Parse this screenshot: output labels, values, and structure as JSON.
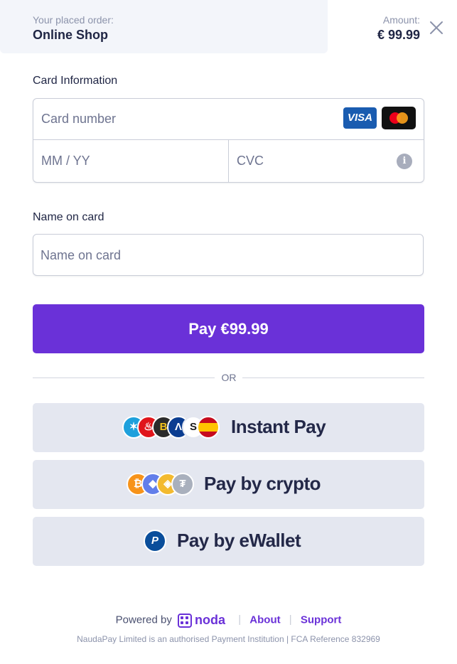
{
  "header": {
    "order_label": "Your placed order:",
    "shop_name": "Online Shop",
    "amount_label": "Amount:",
    "amount_value": "€ 99.99"
  },
  "card_info": {
    "section_label": "Card Information",
    "card_number_placeholder": "Card number",
    "expiry_placeholder": "MM / YY",
    "cvc_placeholder": "CVC",
    "visa_text": "VISA",
    "brands": [
      "visa-logo",
      "mastercard-logo"
    ]
  },
  "name": {
    "section_label": "Name on card",
    "placeholder": "Name on card"
  },
  "pay_button_label": "Pay €99.99",
  "divider_text": "OR",
  "alt_methods": [
    {
      "label": "Instant Pay",
      "icons": [
        "caixabank-icon",
        "santander-icon",
        "bank-b-icon",
        "bank-a-icon",
        "sabadell-icon",
        "spain-flag-icon"
      ]
    },
    {
      "label": "Pay by crypto",
      "icons": [
        "bitcoin-icon",
        "ethereum-icon",
        "binance-icon",
        "tether-icon"
      ]
    },
    {
      "label": "Pay by eWallet",
      "icons": [
        "paypal-icon"
      ]
    }
  ],
  "footer": {
    "powered_by": "Powered by",
    "brand": "noda",
    "about": "About",
    "support": "Support",
    "legal": "NaudaPay Limited is an authorised Payment Institution | FCA Reference 832969"
  },
  "colors": {
    "accent": "#6a31d8",
    "alt_button_bg": "#e4e7f0",
    "header_bg": "#f3f5fa"
  }
}
